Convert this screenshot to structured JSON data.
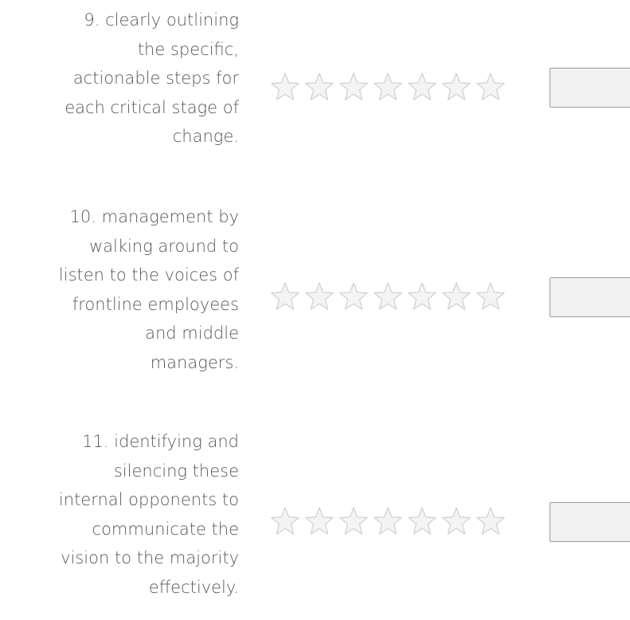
{
  "questions": [
    {
      "text": "9. clearly outlining\nthe specific,\nactionable steps for\neach critical stage of\nchange.",
      "rating": {
        "max": 7,
        "selected": 0
      },
      "input_value": ""
    },
    {
      "text": "10. management by\nwalking around to\nlisten to the voices of\nfrontline employees\nand middle\nmanagers.",
      "rating": {
        "max": 7,
        "selected": 0
      },
      "input_value": ""
    },
    {
      "text": "11. identifying and\nsilencing these\ninternal opponents to\ncommunicate the\nvision to the majority\neffectively.",
      "rating": {
        "max": 7,
        "selected": 0
      },
      "input_value": ""
    }
  ],
  "colors": {
    "text": "#595959",
    "star_fill": "#f4f4f4",
    "star_stroke": "#cfcfcf",
    "input_bg": "#f1f1f1",
    "input_border": "#9a9a9a"
  },
  "icons": {
    "rating_star": "star-outline-icon"
  }
}
